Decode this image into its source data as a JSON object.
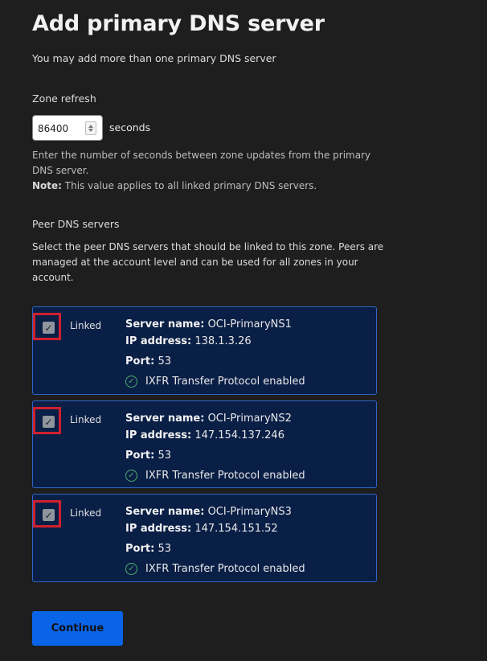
{
  "page": {
    "title": "Add primary DNS server",
    "subtitle": "You may add more than one primary DNS server"
  },
  "zone_refresh": {
    "label": "Zone refresh",
    "value": "86400",
    "unit": "seconds",
    "help": "Enter the number of seconds between zone updates from the primary DNS server.",
    "note_label": "Note:",
    "note_text": " This value applies to all linked primary DNS servers."
  },
  "peers": {
    "label": "Peer DNS servers",
    "help": "Select the peer DNS servers that should be linked to this zone. Peers are managed at the account level and can be used for all zones in your account.",
    "linked_label": "Linked",
    "server_name_label": "Server name:",
    "ip_label": "IP address:",
    "port_label": "Port:",
    "servers": [
      {
        "name": "OCI-PrimaryNS1",
        "ip": "138.1.3.26",
        "port": "53",
        "protocol": "IXFR Transfer Protocol enabled",
        "checked": true
      },
      {
        "name": "OCI-PrimaryNS2",
        "ip": "147.154.137.246",
        "port": "53",
        "protocol": "IXFR Transfer Protocol enabled",
        "checked": true
      },
      {
        "name": "OCI-PrimaryNS3",
        "ip": "147.154.151.52",
        "port": "53",
        "protocol": "IXFR Transfer Protocol enabled",
        "checked": true
      }
    ]
  },
  "actions": {
    "continue_label": "Continue"
  },
  "icons": {
    "check": "checkmark-icon",
    "status": "check-circle-icon"
  },
  "colors": {
    "background": "#1e1e1e",
    "card_bg": "#0a1f46",
    "card_border": "#2f65c8",
    "highlight": "#d0202e",
    "primary_button": "#0a64e8",
    "success": "#4caf6e"
  }
}
